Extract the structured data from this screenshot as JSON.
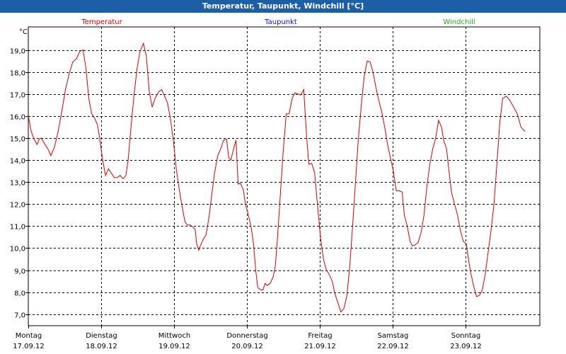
{
  "window": {
    "title": "Temperatur, Taupunkt, Windchill [°C]"
  },
  "chart_data": {
    "type": "line",
    "title": "Temperatur, Taupunkt, Windchill [°C]",
    "ylabel": "°C",
    "ylim": [
      6.5,
      20.0
    ],
    "y_ticks": [
      "19,0",
      "18,0",
      "17,0",
      "16,0",
      "15,0",
      "14,0",
      "13,0",
      "12,0",
      "11,0",
      "10,0",
      "9,0",
      "8,0",
      "7,0"
    ],
    "y_tick_values": [
      19,
      18,
      17,
      16,
      15,
      14,
      13,
      12,
      11,
      10,
      9,
      8,
      7
    ],
    "x_range": [
      0,
      7.1
    ],
    "x_ticks": [
      {
        "day": "Montag",
        "date": "17.09.12",
        "x": 0
      },
      {
        "day": "Dienstag",
        "date": "18.09.12",
        "x": 1
      },
      {
        "day": "Mittwoch",
        "date": "19.09.12",
        "x": 2
      },
      {
        "day": "Donnerstag",
        "date": "20.09.12",
        "x": 3
      },
      {
        "day": "Freitag",
        "date": "21.09.12",
        "x": 4
      },
      {
        "day": "Samstag",
        "date": "22.09.12",
        "x": 5
      },
      {
        "day": "Sonntag",
        "date": "23.09.12",
        "x": 6
      }
    ],
    "grid": true,
    "legend_position": "top",
    "series": [
      {
        "name": "Temperatur",
        "color": "#d40000",
        "points": [
          [
            0.0,
            16.0
          ],
          [
            0.04,
            15.3
          ],
          [
            0.08,
            14.95
          ],
          [
            0.12,
            14.7
          ],
          [
            0.15,
            14.95
          ],
          [
            0.18,
            15.0
          ],
          [
            0.22,
            14.75
          ],
          [
            0.27,
            14.5
          ],
          [
            0.31,
            14.2
          ],
          [
            0.36,
            14.6
          ],
          [
            0.41,
            15.3
          ],
          [
            0.46,
            16.2
          ],
          [
            0.51,
            17.2
          ],
          [
            0.56,
            17.9
          ],
          [
            0.61,
            18.45
          ],
          [
            0.66,
            18.6
          ],
          [
            0.71,
            18.95
          ],
          [
            0.75,
            19.0
          ],
          [
            0.79,
            18.2
          ],
          [
            0.83,
            16.8
          ],
          [
            0.87,
            16.1
          ],
          [
            0.91,
            15.9
          ],
          [
            0.95,
            15.6
          ],
          [
            0.98,
            15.0
          ],
          [
            1.02,
            14.0
          ],
          [
            1.06,
            13.3
          ],
          [
            1.1,
            13.6
          ],
          [
            1.14,
            13.4
          ],
          [
            1.18,
            13.2
          ],
          [
            1.22,
            13.2
          ],
          [
            1.26,
            13.3
          ],
          [
            1.3,
            13.15
          ],
          [
            1.34,
            13.3
          ],
          [
            1.37,
            14.0
          ],
          [
            1.41,
            15.5
          ],
          [
            1.45,
            16.9
          ],
          [
            1.49,
            18.1
          ],
          [
            1.53,
            18.9
          ],
          [
            1.58,
            19.3
          ],
          [
            1.62,
            18.7
          ],
          [
            1.66,
            17.1
          ],
          [
            1.7,
            16.4
          ],
          [
            1.74,
            16.8
          ],
          [
            1.79,
            17.1
          ],
          [
            1.83,
            17.2
          ],
          [
            1.87,
            16.9
          ],
          [
            1.91,
            16.6
          ],
          [
            1.95,
            15.9
          ],
          [
            1.99,
            14.9
          ],
          [
            2.03,
            13.6
          ],
          [
            2.07,
            12.7
          ],
          [
            2.11,
            11.9
          ],
          [
            2.15,
            11.2
          ],
          [
            2.18,
            11.05
          ],
          [
            2.22,
            11.05
          ],
          [
            2.26,
            10.95
          ],
          [
            2.29,
            10.85
          ],
          [
            2.31,
            10.2
          ],
          [
            2.34,
            9.9
          ],
          [
            2.36,
            10.1
          ],
          [
            2.4,
            10.4
          ],
          [
            2.44,
            10.6
          ],
          [
            2.48,
            11.4
          ],
          [
            2.52,
            12.5
          ],
          [
            2.56,
            13.5
          ],
          [
            2.6,
            14.2
          ],
          [
            2.64,
            14.5
          ],
          [
            2.68,
            14.9
          ],
          [
            2.72,
            14.95
          ],
          [
            2.75,
            14.1
          ],
          [
            2.78,
            14.0
          ],
          [
            2.82,
            14.55
          ],
          [
            2.85,
            14.9
          ],
          [
            2.88,
            12.9
          ],
          [
            2.91,
            12.95
          ],
          [
            2.95,
            12.65
          ],
          [
            2.98,
            12.0
          ],
          [
            3.02,
            11.5
          ],
          [
            3.06,
            10.9
          ],
          [
            3.09,
            10.2
          ],
          [
            3.12,
            9.0
          ],
          [
            3.15,
            8.2
          ],
          [
            3.19,
            8.1
          ],
          [
            3.22,
            8.1
          ],
          [
            3.25,
            8.4
          ],
          [
            3.28,
            8.3
          ],
          [
            3.32,
            8.4
          ],
          [
            3.36,
            8.7
          ],
          [
            3.39,
            9.2
          ],
          [
            3.42,
            10.5
          ],
          [
            3.46,
            12.5
          ],
          [
            3.5,
            14.5
          ],
          [
            3.54,
            16.1
          ],
          [
            3.58,
            16.1
          ],
          [
            3.62,
            16.8
          ],
          [
            3.66,
            17.05
          ],
          [
            3.7,
            17.0
          ],
          [
            3.74,
            16.95
          ],
          [
            3.78,
            17.2
          ],
          [
            3.82,
            15.0
          ],
          [
            3.85,
            13.8
          ],
          [
            3.89,
            13.85
          ],
          [
            3.93,
            13.4
          ],
          [
            3.97,
            11.9
          ],
          [
            4.01,
            10.5
          ],
          [
            4.05,
            9.5
          ],
          [
            4.09,
            9.0
          ],
          [
            4.13,
            8.8
          ],
          [
            4.17,
            8.5
          ],
          [
            4.21,
            7.9
          ],
          [
            4.25,
            7.5
          ],
          [
            4.29,
            7.1
          ],
          [
            4.33,
            7.25
          ],
          [
            4.37,
            7.8
          ],
          [
            4.41,
            9.1
          ],
          [
            4.45,
            11.0
          ],
          [
            4.49,
            13.0
          ],
          [
            4.53,
            15.0
          ],
          [
            4.57,
            16.5
          ],
          [
            4.61,
            17.8
          ],
          [
            4.65,
            18.5
          ],
          [
            4.69,
            18.45
          ],
          [
            4.73,
            18.0
          ],
          [
            4.77,
            17.3
          ],
          [
            4.81,
            16.7
          ],
          [
            4.85,
            16.2
          ],
          [
            4.89,
            15.5
          ],
          [
            4.93,
            14.7
          ],
          [
            4.97,
            14.1
          ],
          [
            5.01,
            13.5
          ],
          [
            5.05,
            12.6
          ],
          [
            5.09,
            12.6
          ],
          [
            5.13,
            12.55
          ],
          [
            5.16,
            11.5
          ],
          [
            5.2,
            11.0
          ],
          [
            5.24,
            10.3
          ],
          [
            5.27,
            10.1
          ],
          [
            5.31,
            10.15
          ],
          [
            5.35,
            10.25
          ],
          [
            5.39,
            10.7
          ],
          [
            5.43,
            11.5
          ],
          [
            5.47,
            12.8
          ],
          [
            5.51,
            13.8
          ],
          [
            5.55,
            14.5
          ],
          [
            5.59,
            15.0
          ],
          [
            5.63,
            15.8
          ],
          [
            5.67,
            15.5
          ],
          [
            5.7,
            14.9
          ],
          [
            5.74,
            14.5
          ],
          [
            5.78,
            13.3
          ],
          [
            5.81,
            12.5
          ],
          [
            5.85,
            12.0
          ],
          [
            5.89,
            11.5
          ],
          [
            5.93,
            10.8
          ],
          [
            5.97,
            10.3
          ],
          [
            6.01,
            10.2
          ],
          [
            6.04,
            9.5
          ],
          [
            6.07,
            8.9
          ],
          [
            6.11,
            8.3
          ],
          [
            6.15,
            7.8
          ],
          [
            6.19,
            7.85
          ],
          [
            6.23,
            8.1
          ],
          [
            6.27,
            8.8
          ],
          [
            6.31,
            9.8
          ],
          [
            6.35,
            10.8
          ],
          [
            6.39,
            12.0
          ],
          [
            6.43,
            13.8
          ],
          [
            6.47,
            15.7
          ],
          [
            6.51,
            16.8
          ],
          [
            6.56,
            16.9
          ],
          [
            6.61,
            16.7
          ],
          [
            6.66,
            16.4
          ],
          [
            6.71,
            16.1
          ],
          [
            6.76,
            15.5
          ],
          [
            6.8,
            15.35
          ],
          [
            6.82,
            15.3
          ]
        ]
      },
      {
        "name": "Taupunkt",
        "color": "#1010c0",
        "points": []
      },
      {
        "name": "Windchill",
        "color": "#20b020",
        "points": []
      }
    ]
  }
}
